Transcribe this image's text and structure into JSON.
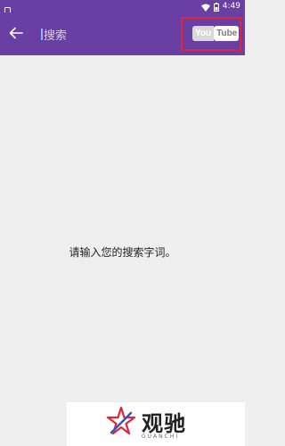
{
  "status_bar": {
    "time": "4:49",
    "icons": [
      "notification-icon",
      "wifi-icon",
      "battery-icon"
    ]
  },
  "app_bar": {
    "back_icon": "arrow-left-icon",
    "search_placeholder": "搜索",
    "logo": {
      "you": "You",
      "tube": "Tube"
    },
    "background_color": "#6a3fa3",
    "highlight_color": "#e0273a"
  },
  "main": {
    "empty_message": "请输入您的搜索字词。"
  },
  "watermark": {
    "name": "观驰",
    "latin": "GUANCHI"
  }
}
